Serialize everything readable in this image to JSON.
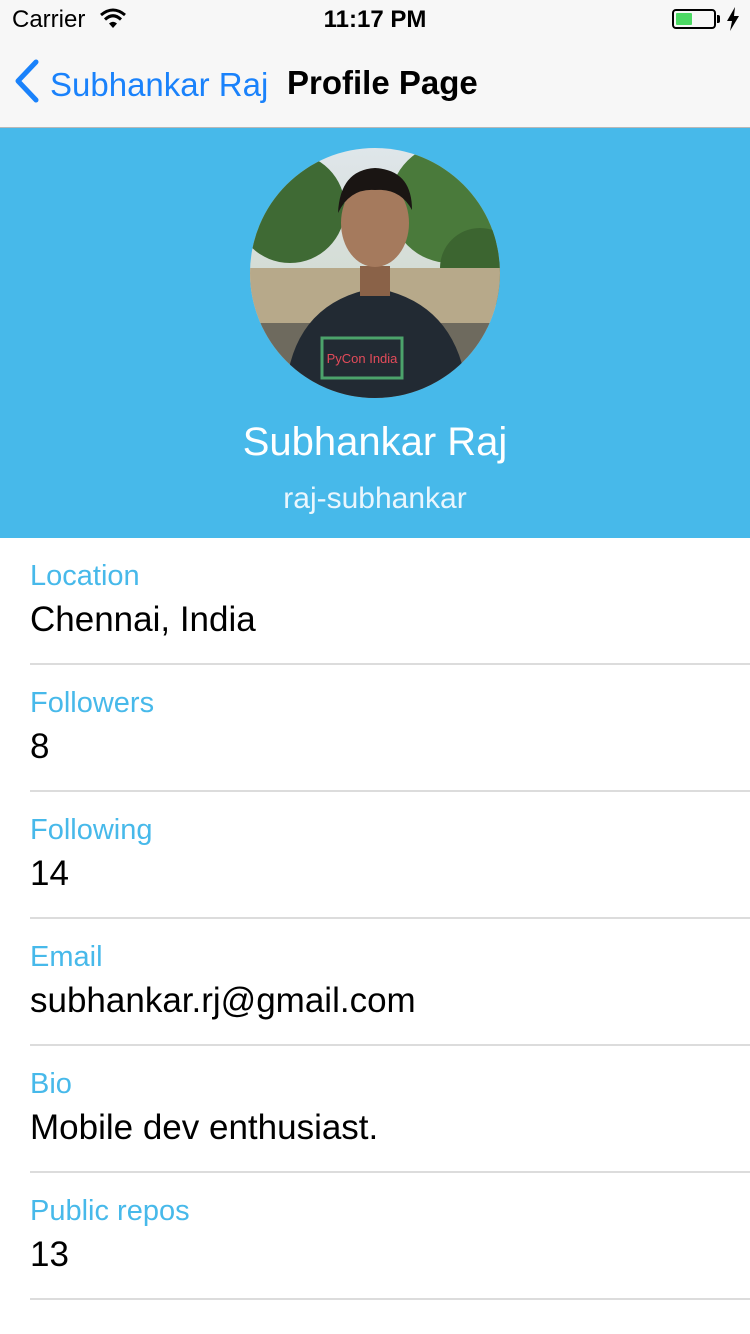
{
  "status_bar": {
    "carrier": "Carrier",
    "time": "11:17 PM",
    "battery_level": 0.45,
    "battery_color": "#4cd964"
  },
  "nav": {
    "back_label": "Subhankar Raj",
    "back_icon": "chevron-left-icon",
    "title": "Profile Page",
    "tint": "#1a82fb"
  },
  "profile": {
    "name": "Subhankar Raj",
    "username": "raj-subhankar",
    "header_color": "#47b9ea",
    "avatar_icon": "avatar-photo",
    "shirt_text": "PyCon India"
  },
  "details": [
    {
      "label": "Location",
      "value": "Chennai, India"
    },
    {
      "label": "Followers",
      "value": "8"
    },
    {
      "label": "Following",
      "value": "14"
    },
    {
      "label": "Email",
      "value": "subhankar.rj@gmail.com"
    },
    {
      "label": "Bio",
      "value": "Mobile dev enthusiast."
    },
    {
      "label": "Public repos",
      "value": "13"
    }
  ]
}
